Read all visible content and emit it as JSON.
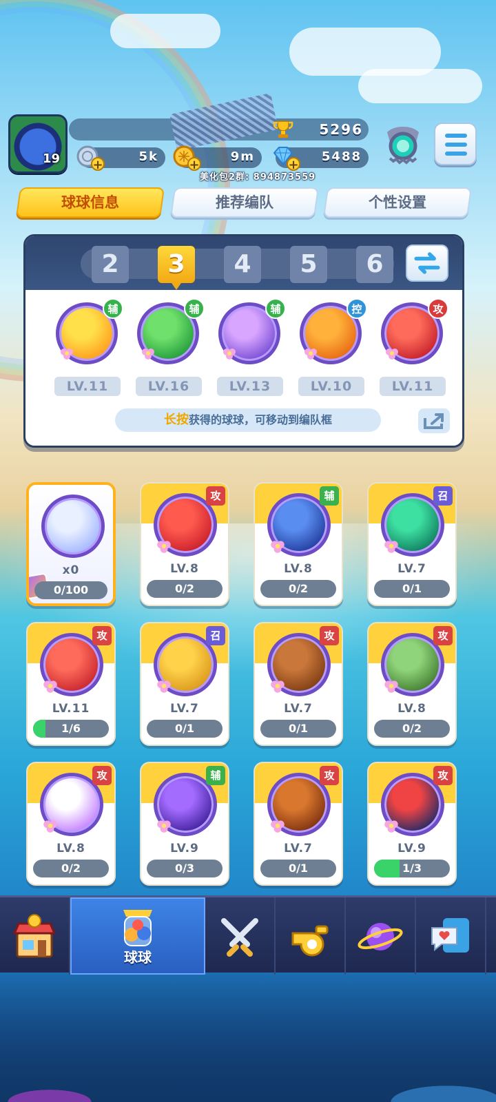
{
  "player": {
    "level": "19",
    "trophies": "5296",
    "currency_silver": "5k",
    "currency_gold": "9m",
    "gems": "5488",
    "group_text": "美化包2群: 894873559"
  },
  "tabs": [
    {
      "label": "球球信息",
      "active": true
    },
    {
      "label": "推荐编队",
      "active": false
    },
    {
      "label": "个性设置",
      "active": false
    }
  ],
  "team_tabs": [
    "2",
    "3",
    "4",
    "5",
    "6"
  ],
  "team_active_index": 1,
  "team": [
    {
      "role": "辅",
      "level": "LV.11",
      "colors": [
        "#ffe04a",
        "#ff9d1f"
      ],
      "icon": "sun-ball-icon"
    },
    {
      "role": "辅",
      "level": "LV.16",
      "colors": [
        "#6fe06b",
        "#239c3c"
      ],
      "icon": "arrow-up-ball-icon"
    },
    {
      "role": "辅",
      "level": "LV.13",
      "colors": [
        "#d9a6ff",
        "#7a4fd6"
      ],
      "icon": "silhouette-ball-icon"
    },
    {
      "role": "控",
      "level": "LV.10",
      "colors": [
        "#ffb13b",
        "#e86a14"
      ],
      "icon": "paw-ball-icon"
    },
    {
      "role": "攻",
      "level": "LV.11",
      "colors": [
        "#ff6b5a",
        "#c5222c"
      ],
      "icon": "dino-ball-icon"
    }
  ],
  "hint": {
    "highlight": "长按",
    "text": "获得的球球，可移动到编队框"
  },
  "cards": [
    {
      "special": true,
      "count": "x0",
      "progress": "0/100",
      "fill": 0,
      "colors": [
        "#e9f0ff",
        "#9fb4ff"
      ],
      "icon": "reroll-ball-icon"
    },
    {
      "tag": "攻",
      "tag_class": "gong",
      "level": "LV.8",
      "progress": "0/2",
      "fill": 0,
      "colors": [
        "#ff5a4e",
        "#c71d2a"
      ],
      "icon": "red-blob-ball-icon"
    },
    {
      "tag": "辅",
      "tag_class": "fu",
      "level": "LV.8",
      "progress": "0/2",
      "fill": 0,
      "colors": [
        "#5a8df0",
        "#1f3a9a"
      ],
      "icon": "hex-ball-icon"
    },
    {
      "tag": "召",
      "tag_class": "zhao",
      "level": "LV.7",
      "progress": "0/1",
      "fill": 0,
      "colors": [
        "#3ee0a2",
        "#0e7a5c"
      ],
      "icon": "swirl-ball-icon"
    },
    {
      "tag": "攻",
      "tag_class": "gong",
      "level": "LV.11",
      "progress": "1/6",
      "fill": 0.1667,
      "colors": [
        "#ff6b5a",
        "#c5222c"
      ],
      "icon": "dino-ball-icon"
    },
    {
      "tag": "召",
      "tag_class": "zhao",
      "level": "LV.7",
      "progress": "0/1",
      "fill": 0,
      "colors": [
        "#ffd24a",
        "#d9951a"
      ],
      "icon": "yellow-bear-ball-icon"
    },
    {
      "tag": "攻",
      "tag_class": "gong",
      "level": "LV.7",
      "progress": "0/1",
      "fill": 0,
      "colors": [
        "#c9773a",
        "#7a3a12"
      ],
      "icon": "brown-bear-ball-icon"
    },
    {
      "tag": "攻",
      "tag_class": "gong",
      "level": "LV.8",
      "progress": "0/2",
      "fill": 0,
      "colors": [
        "#8fd47a",
        "#3f7a2e"
      ],
      "icon": "logger-ball-icon"
    },
    {
      "tag": "攻",
      "tag_class": "gong",
      "level": "LV.8",
      "progress": "0/2",
      "fill": 0,
      "colors": [
        "#ffffff",
        "#c37bff"
      ],
      "icon": "shark-ball-icon"
    },
    {
      "tag": "辅",
      "tag_class": "fu",
      "level": "LV.9",
      "progress": "0/3",
      "fill": 0,
      "colors": [
        "#a46bff",
        "#3d1f9a"
      ],
      "icon": "lightning-ball-icon"
    },
    {
      "tag": "攻",
      "tag_class": "gong",
      "level": "LV.7",
      "progress": "0/1",
      "fill": 0,
      "colors": [
        "#d9772e",
        "#7a2e0e"
      ],
      "icon": "infinity-ball-icon"
    },
    {
      "tag": "攻",
      "tag_class": "gong",
      "level": "LV.9",
      "progress": "1/3",
      "fill": 0.3333,
      "colors": [
        "#f04444",
        "#1a2a66"
      ],
      "icon": "opera-mask-ball-icon"
    }
  ],
  "nav": [
    {
      "name": "shop",
      "label": "",
      "icon": "shop-icon"
    },
    {
      "name": "balls",
      "label": "球球",
      "icon": "balls-icon",
      "active": true
    },
    {
      "name": "battle",
      "label": "",
      "icon": "swords-icon"
    },
    {
      "name": "coach",
      "label": "",
      "icon": "whistle-icon"
    },
    {
      "name": "planet",
      "label": "",
      "icon": "planet-icon"
    },
    {
      "name": "social",
      "label": "",
      "icon": "chat-heart-icon"
    }
  ]
}
